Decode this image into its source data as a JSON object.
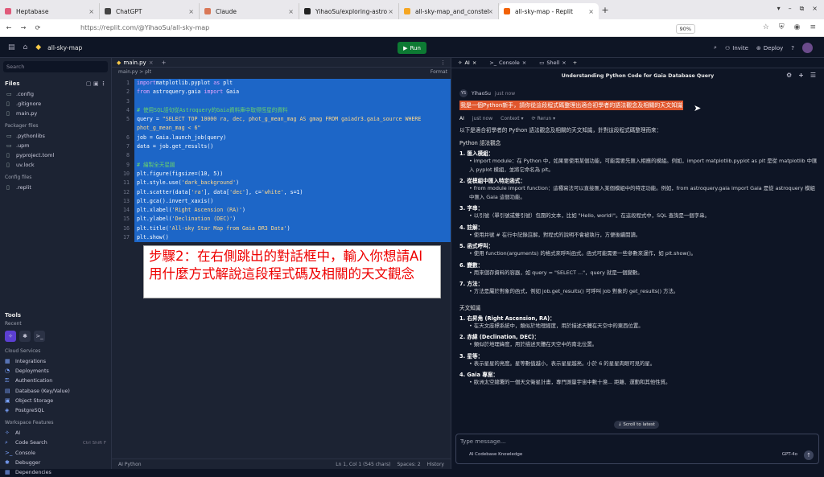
{
  "browser": {
    "tabs": [
      {
        "label": "Heptabase",
        "color": "#e05a7a"
      },
      {
        "label": "ChatGPT",
        "color": "#444444"
      },
      {
        "label": "Claude",
        "color": "#d97757"
      },
      {
        "label": "YihaoSu/exploring-astro",
        "color": "#222222"
      },
      {
        "label": "all-sky-map_and_constel",
        "color": "#f5a623"
      },
      {
        "label": "all-sky-map - Replit",
        "color": "#f26207"
      }
    ],
    "url": "https://replit.com/@YihaoSu/all-sky-map",
    "zoom": "90%"
  },
  "replit_top": {
    "repl_name": "all-sky-map",
    "run_label": "Run",
    "invite_label": "Invite",
    "deploy_label": "Deploy"
  },
  "sidebar": {
    "search_placeholder": "Search",
    "files_title": "Files",
    "files": [
      ".config",
      ".gitignore",
      "main.py"
    ],
    "packager_title": "Packager files",
    "packager_files": [
      ".pythonlibs",
      ".upm",
      "pyproject.toml",
      "uv.lock"
    ],
    "config_title": "Config files",
    "config_files": [
      ".replit"
    ],
    "tools_title": "Tools",
    "recent_label": "Recent",
    "cloud_title": "Cloud Services",
    "cloud_items": [
      "Integrations",
      "Deployments",
      "Authentication",
      "Database (Key/Value)",
      "Object Storage",
      "PostgreSQL"
    ],
    "workspace_title": "Workspace Features",
    "workspace_items": [
      "AI",
      "Code Search",
      "Console",
      "Debugger",
      "Dependencies"
    ],
    "code_search_shortcut": "Ctrl Shift F"
  },
  "editor": {
    "tab_label": "main.py",
    "breadcrumb": "main.py  >  plt",
    "format_label": "Format",
    "lines": [
      {
        "n": "1",
        "parts": [
          [
            "kw",
            "import"
          ],
          [
            "",
            "matplotlib.pyplot "
          ],
          [
            "kw",
            "as"
          ],
          [
            "",
            " plt"
          ]
        ]
      },
      {
        "n": "2",
        "parts": [
          [
            "kw",
            "from"
          ],
          [
            "",
            " astroquery.gaia "
          ],
          [
            "kw",
            "import"
          ],
          [
            "",
            " Gaia"
          ]
        ]
      },
      {
        "n": "3",
        "parts": [
          [
            "",
            ""
          ]
        ]
      },
      {
        "n": "4",
        "parts": [
          [
            "cm",
            "# 使用SQL語句從Astroquery的Gaia資料庫中取得恆星的資料"
          ]
        ]
      },
      {
        "n": "5",
        "parts": [
          [
            "",
            "query = "
          ],
          [
            "str",
            "\"SELECT TOP 10000 ra, dec, phot_g_mean_mag AS gmag FROM gaiadr3.gaia_source WHERE"
          ]
        ]
      },
      {
        "n": "",
        "parts": [
          [
            "str",
            "phot_g_mean_mag < 6\""
          ]
        ]
      },
      {
        "n": "6",
        "parts": [
          [
            "",
            "job = Gaia.launch_job(query)"
          ]
        ]
      },
      {
        "n": "7",
        "parts": [
          [
            "",
            "data = job.get_results()"
          ]
        ]
      },
      {
        "n": "8",
        "parts": [
          [
            "",
            ""
          ]
        ]
      },
      {
        "n": "9",
        "parts": [
          [
            "cm",
            "# 繪製全天星圖"
          ]
        ]
      },
      {
        "n": "10",
        "parts": [
          [
            "",
            "plt.figure(figsize=(10, 5))"
          ]
        ]
      },
      {
        "n": "11",
        "parts": [
          [
            "",
            "plt.style.use("
          ],
          [
            "str",
            "'dark_background'"
          ],
          [
            "",
            ")"
          ]
        ]
      },
      {
        "n": "12",
        "parts": [
          [
            "",
            "plt.scatter(data["
          ],
          [
            "str",
            "'ra'"
          ],
          [
            "",
            "], data["
          ],
          [
            "str",
            "'dec'"
          ],
          [
            "",
            "], c="
          ],
          [
            "str",
            "'white'"
          ],
          [
            "",
            ", s=1)"
          ]
        ]
      },
      {
        "n": "13",
        "parts": [
          [
            "",
            "plt.gca().invert_xaxis()"
          ]
        ]
      },
      {
        "n": "14",
        "parts": [
          [
            "",
            "plt.xlabel("
          ],
          [
            "str",
            "'Right Ascension (RA)'"
          ],
          [
            "",
            ")"
          ]
        ]
      },
      {
        "n": "15",
        "parts": [
          [
            "",
            "plt.ylabel("
          ],
          [
            "str",
            "'Declination (DEC)'"
          ],
          [
            "",
            ")"
          ]
        ]
      },
      {
        "n": "16",
        "parts": [
          [
            "",
            "plt.title("
          ],
          [
            "str",
            "'All-sky Star Map from Gaia DR3 Data'"
          ],
          [
            "",
            ")"
          ]
        ]
      },
      {
        "n": "17",
        "parts": [
          [
            "",
            "plt.show()"
          ]
        ]
      }
    ],
    "note_text": "步驟2：在右側跳出的對話框中，輸入你想請AI用什麼方式解說這段程式碼及相關的天文觀念",
    "status_left": "AI    Python",
    "status_pos": "Ln 1, Col 1 (545 chars)",
    "status_spaces": "Spaces: 2",
    "status_history": "History"
  },
  "ai": {
    "tabs": [
      "AI",
      "Console",
      "Shell"
    ],
    "title": "Understanding Python Code for Gaia Database Query",
    "user_name": "YihaoSu",
    "user_time": "just now",
    "user_avatar": "YS",
    "prompt": "我是一個Python新手，請你從這段程式碼整理出適合初學者的語法觀念及相關的天文知識",
    "ai_name": "AI",
    "ai_time": "just now",
    "context_label": "Context",
    "rerun_label": "Rerun",
    "intro": "以下是適合初學者的 Python 語法觀念及相關的天文知識，針對這段程式碼整理而來：",
    "syntax_title": "Python 語法觀念",
    "syntax_items": [
      {
        "title": "1. 匯入模組：",
        "body": "• import module：在 Python 中，如果要使用某個功能，可能需要先匯入相應的模組。例如，import matplotlib.pyplot as plt 是從 matplotlib 中匯入 pyplot 模組，並將它命名為 plt。"
      },
      {
        "title": "2. 從模組中匯入特定函式：",
        "body": "• from module import function：這種寫法可以直接匯入某個模組中的特定功能。例如，from astroquery.gaia import Gaia 是從 astroquery 模組中匯入 Gaia 這個功能。"
      },
      {
        "title": "3. 字串：",
        "body": "• 以引號（單引號或雙引號）包圍的文本，比如 \"Hello, world!\"。在這段程式中，SQL 查詢是一個字串。"
      },
      {
        "title": "4. 註解：",
        "body": "• 使用井號 # 在行中記錄註解，對程式的說明不會被執行，方便後續閱讀。"
      },
      {
        "title": "5. 函式呼叫：",
        "body": "• 使用 function(arguments) 的格式來呼叫函式。函式可能需要一些參數來運作，如 plt.show()。"
      },
      {
        "title": "6. 變數：",
        "body": "• 用來儲存資料的容器，如 query = \"SELECT ...\"，query 就是一個變數。"
      },
      {
        "title": "7. 方法：",
        "body": "• 方法是屬於對象的函式，例如 job.get_results() 可呼叫 job 對象的 get_results() 方法。"
      }
    ],
    "astro_title": "天文知識",
    "astro_items": [
      {
        "title": "1. 右昇角 (Right Ascension, RA)：",
        "body": "• 在天文座標系統中，類似於地理經度，用於描述天體在天空中的東西位置。"
      },
      {
        "title": "2. 赤緯 (Declination, DEC)：",
        "body": "• 類似於地理緯度，用於描述天體在天空中的南北位置。"
      },
      {
        "title": "3. 星等：",
        "body": "• 表示星星的亮度。星等數值越小，表示星星越亮。小於 6 的星星肉眼可見的星。"
      },
      {
        "title": "4. Gaia 專案：",
        "body": "• 歐洲太空總署的一個天文衛星計畫，專門測量宇宙中數十億... 距離、運動和其他性質。"
      }
    ],
    "scroll_latest": "Scroll to latest",
    "input_placeholder": "Type message...",
    "knowledge_label": "AI Codebase Knowledge",
    "model_label": "GPT-4o"
  }
}
